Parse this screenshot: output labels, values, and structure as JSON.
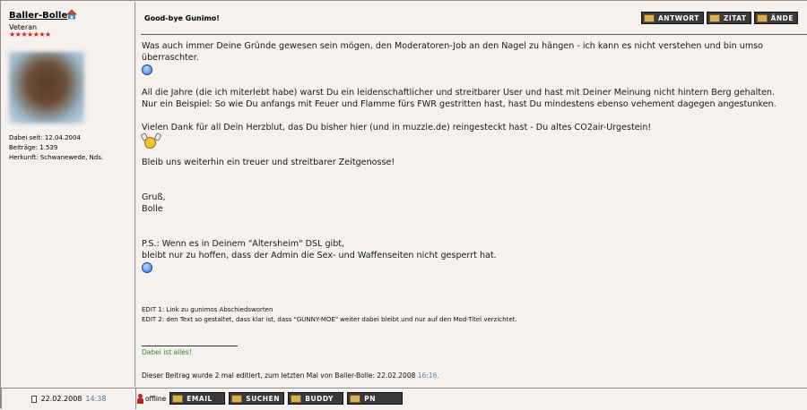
{
  "author": {
    "name": "Baller-Bolle",
    "rank": "Veteran",
    "stars": "★★★★★★★",
    "stats": {
      "since": "Dabei seit: 12.04.2004",
      "posts": "Beiträge: 1.539",
      "origin": "Herkunft: Schwanewede, Nds."
    }
  },
  "post": {
    "title": "Good-bye Gunimo!",
    "buttons": {
      "reply": "ANTWORT",
      "quote": "ZITAT",
      "edit": "ÄNDE"
    },
    "paragraphs": {
      "p1": "Was auch immer Deine Gründe gewesen sein mögen, den Moderatoren-Job an den Nagel zu hängen - ich kann es nicht verstehen und bin umso überraschter.",
      "p2a": "All die Jahre (die ich miterlebt habe) warst Du ein leidenschaftlicher und streitbarer User und hast mit Deiner Meinung nicht hintern Berg gehalten.",
      "p2b": "Nur ein Beispiel: So wie Du anfangs mit Feuer und Flamme fürs FWR gestritten hast, hast Du mindestens ebenso vehement dagegen angestunken.",
      "p3": "Vielen Dank für all Dein Herzblut, das Du bisher hier (und in muzzle.de) reingesteckt hast - Du altes CO2air-Urgestein!",
      "p4": "Bleib uns weiterhin ein treuer und streitbarer Zeitgenosse!",
      "greet1": "Gruß,",
      "greet2": "Bolle",
      "ps1": "P.S.: Wenn es in Deinem \"Altersheim\" DSL gibt,",
      "ps2": "bleibt nur zu hoffen, dass der Admin die Sex- und Waffenseiten nicht gesperrt hat."
    },
    "edits": {
      "e1": "EDIT 1: Link zu gunimos Abschiedsworten",
      "e2": "EDIT 2: den Text so gestaltet, dass klar ist, dass \"GUNNY-MOE\" weiter dabei bleibt und nur auf den Mod-Titel verzichtet."
    },
    "signature": "Dabei ist alles!",
    "edited_note": "Dieser Beitrag wurde 2 mal editiert, zum letzten Mal von Baller-Bolle: 22.02.2008",
    "edited_time": "16:16."
  },
  "footer": {
    "date": "22.02.2008",
    "time": "14:38",
    "status": "offline",
    "buttons": {
      "email": "EMAIL",
      "search": "SUCHEN",
      "buddy": "BUDDY",
      "pm": "PN"
    }
  }
}
